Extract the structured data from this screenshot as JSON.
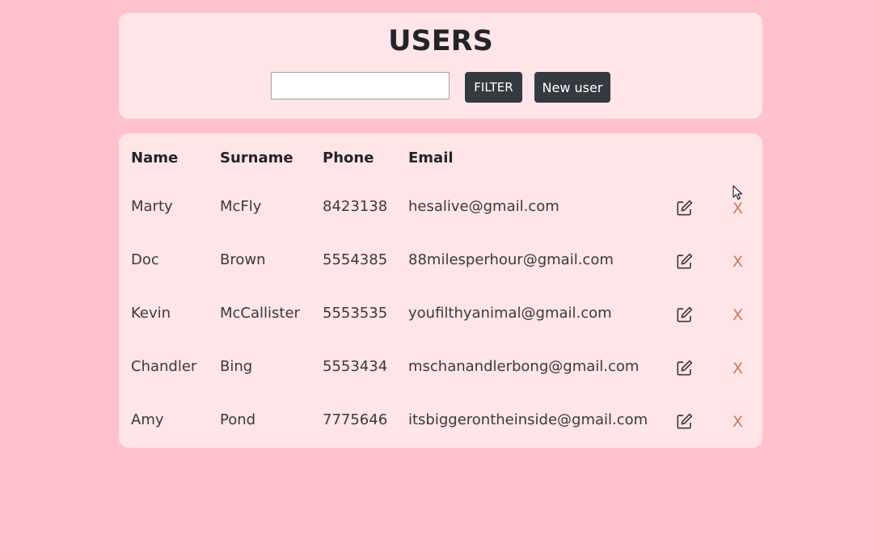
{
  "header": {
    "title": "USERS",
    "filter_input_value": "",
    "filter_input_placeholder": "",
    "filter_label": "FILTER",
    "new_user_label": "New user"
  },
  "table": {
    "columns": [
      "Name",
      "Surname",
      "Phone",
      "Email"
    ],
    "rows": [
      {
        "name": "Marty",
        "surname": "McFly",
        "phone": "8423138",
        "email": "hesalive@gmail.com",
        "delete_label": "X",
        "edit_icon": "edit-icon"
      },
      {
        "name": "Doc",
        "surname": "Brown",
        "phone": "5554385",
        "email": "88milesperhour@gmail.com",
        "delete_label": "X",
        "edit_icon": "edit-icon"
      },
      {
        "name": "Kevin",
        "surname": "McCallister",
        "phone": "5553535",
        "email": "youfilthyanimal@gmail.com",
        "delete_label": "X",
        "edit_icon": "edit-icon"
      },
      {
        "name": "Chandler",
        "surname": "Bing",
        "phone": "5553434",
        "email": "mschanandlerbong@gmail.com",
        "delete_label": "X",
        "edit_icon": "edit-icon"
      },
      {
        "name": "Amy",
        "surname": "Pond",
        "phone": "7775646",
        "email": "itsbiggerontheinside@gmail.com",
        "delete_label": "X",
        "edit_icon": "edit-icon"
      }
    ]
  },
  "colors": {
    "page_background": "#ffc2cd",
    "card_background": "#ffe4e8",
    "button_background": "#343a40",
    "button_text": "#ffffff",
    "delete_color": "#cc7a55",
    "text": "#212529"
  }
}
